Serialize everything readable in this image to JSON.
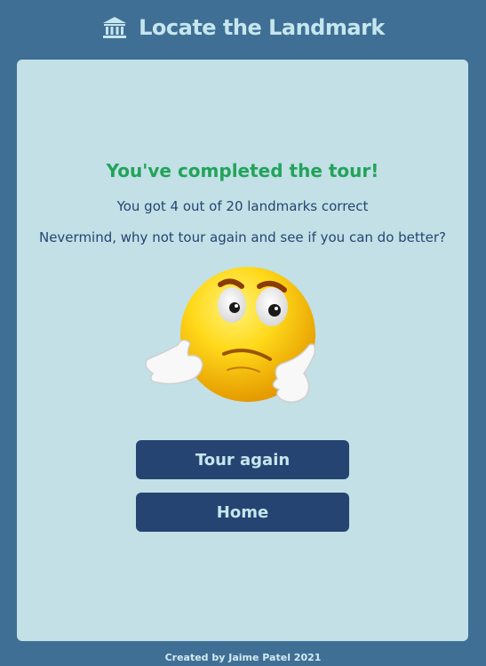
{
  "header": {
    "title": "Locate the Landmark",
    "icon": "landmark-building-icon"
  },
  "result": {
    "heading": "You've completed the tour!",
    "score_text": "You got 4 out of 20 landmarks correct",
    "message": "Nevermind, why not tour again and see if you can do better?",
    "illustration": "confused-emoji-shrug"
  },
  "buttons": {
    "tour_again": "Tour again",
    "home": "Home"
  },
  "footer": {
    "credit": "Created by Jaime Patel 2021"
  },
  "colors": {
    "background": "#3f6f95",
    "card": "#c2e0e6",
    "heading_green": "#22a35a",
    "text_navy": "#274472",
    "button": "#264472",
    "header_text": "#c6e6ee"
  }
}
